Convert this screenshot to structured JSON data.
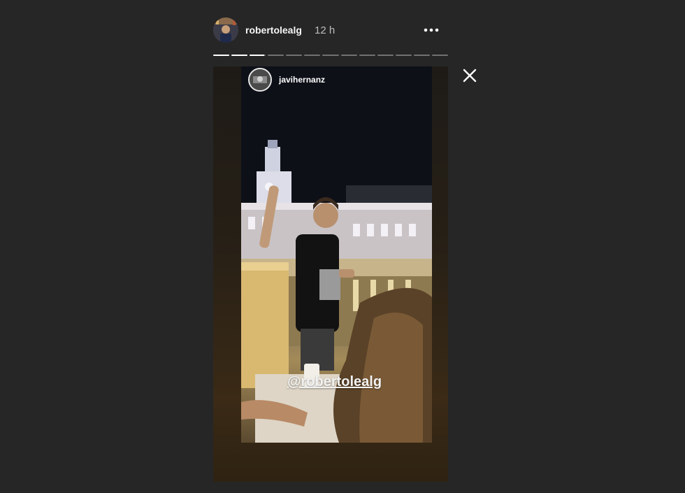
{
  "header": {
    "username": "robertolealg",
    "timestamp": "12 h",
    "avatar_icon": "user-avatar-icon",
    "more_icon": "more-options-icon"
  },
  "progress": {
    "segment_count": 13,
    "current_segment": 3,
    "current_segment_fraction": 0.9
  },
  "story": {
    "reshared_from": {
      "username": "javihernanz",
      "avatar_icon": "user-avatar-icon"
    },
    "mention_sticker": "@robertolealg"
  },
  "close_icon": "close-icon",
  "colors": {
    "background": "#262626",
    "text_primary": "#f5f5f5",
    "text_secondary": "#bdbdbd",
    "progress_active": "#ffffff"
  }
}
